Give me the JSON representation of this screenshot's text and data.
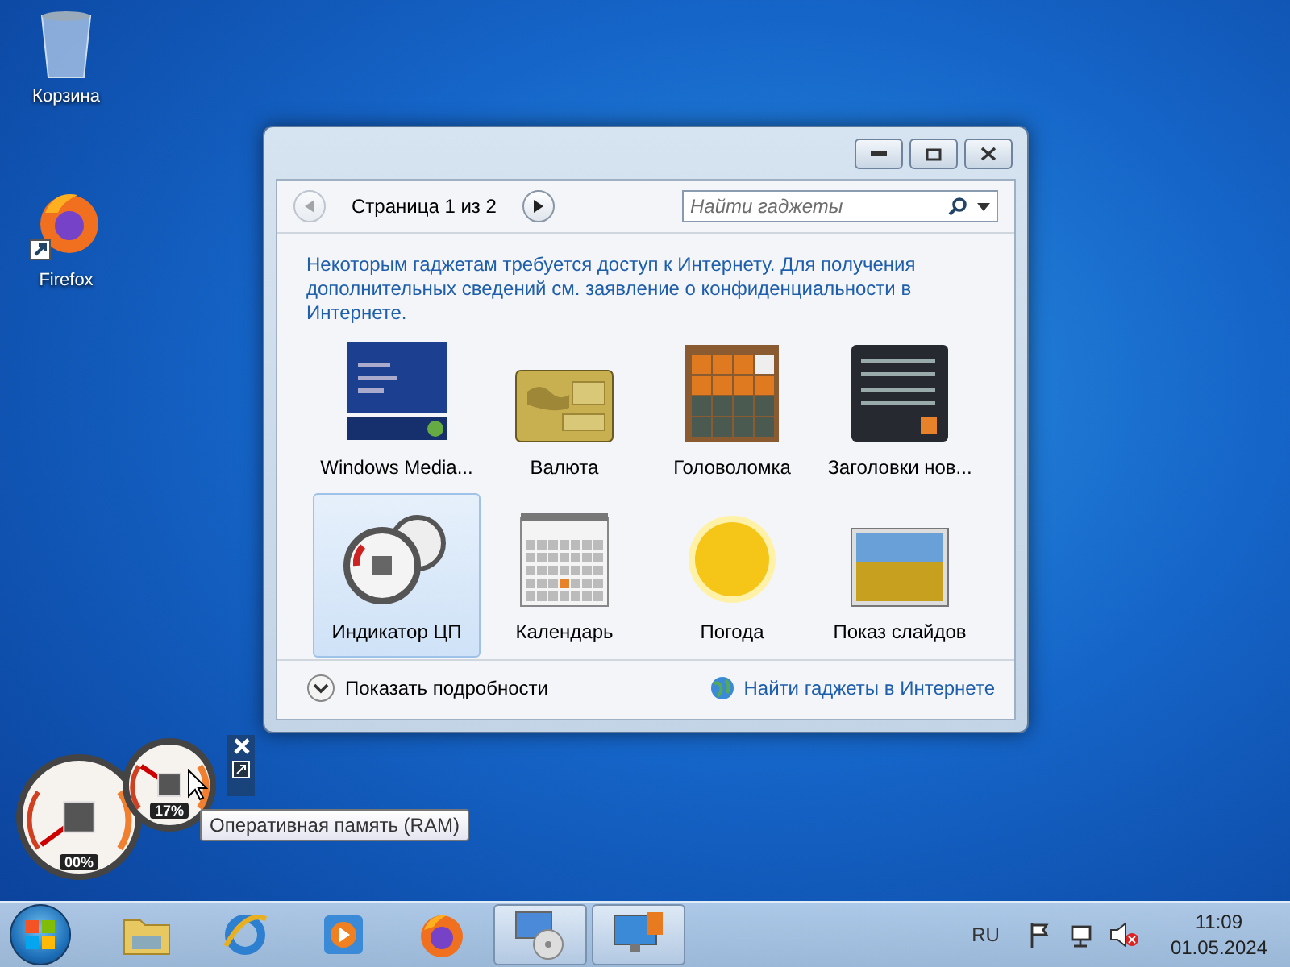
{
  "desktop_icons": [
    {
      "label": "Корзина",
      "kind": "bin"
    },
    {
      "label": "Firefox",
      "kind": "firefox"
    }
  ],
  "gadget_window": {
    "pager": {
      "label": "Страница 1 из 2"
    },
    "search": {
      "placeholder": "Найти гаджеты"
    },
    "notice": "Некоторым гаджетам требуется доступ к Интернету. Для получения дополнительных сведений см. заявление о конфиденциальности в Интернете.",
    "gadgets": [
      {
        "label": "Windows Media...",
        "kind": "media",
        "selected": false
      },
      {
        "label": "Валюта",
        "kind": "currency",
        "selected": false
      },
      {
        "label": "Головоломка",
        "kind": "puzzle",
        "selected": false
      },
      {
        "label": "Заголовки нов...",
        "kind": "news",
        "selected": false
      },
      {
        "label": "Индикатор ЦП",
        "kind": "meter",
        "selected": true
      },
      {
        "label": "Календарь",
        "kind": "calendar",
        "selected": false
      },
      {
        "label": "Погода",
        "kind": "weather",
        "selected": false
      },
      {
        "label": "Показ слайдов",
        "kind": "slides",
        "selected": false
      }
    ],
    "details": "Показать подробности",
    "online_link": "Найти гаджеты в Интернете"
  },
  "cpu_gadget": {
    "cpu_reading": "00%",
    "ram_reading": "17%",
    "tooltip": "Оперативная память (RAM)"
  },
  "taskbar": {
    "apps": [
      {
        "kind": "folder",
        "active": false
      },
      {
        "kind": "browser",
        "active": false
      },
      {
        "kind": "player",
        "active": false
      },
      {
        "kind": "firefox",
        "active": false
      },
      {
        "kind": "disc",
        "active": true
      },
      {
        "kind": "monitor",
        "active": true
      }
    ],
    "language": "RU",
    "time": "11:09",
    "date": "01.05.2024"
  }
}
